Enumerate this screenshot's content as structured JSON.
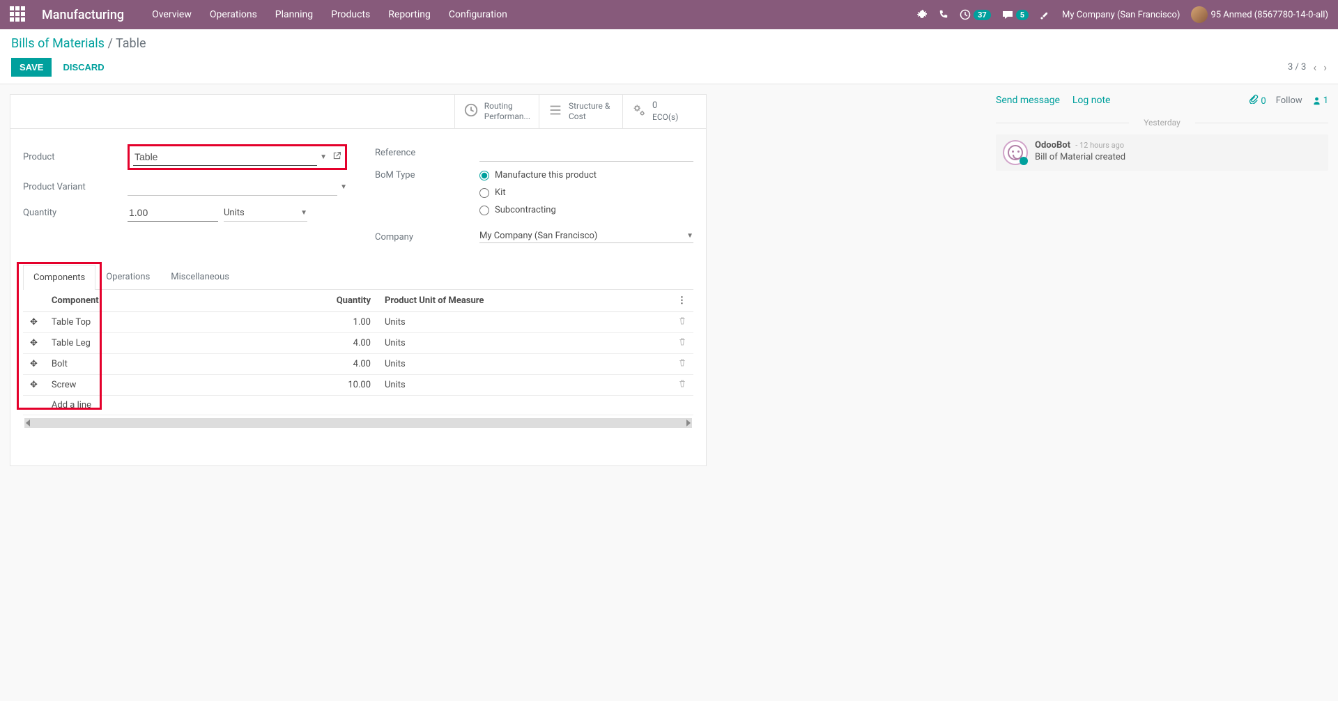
{
  "nav": {
    "brand": "Manufacturing",
    "menu": [
      "Overview",
      "Operations",
      "Planning",
      "Products",
      "Reporting",
      "Configuration"
    ],
    "clock_badge": "37",
    "chat_badge": "5",
    "company": "My Company (San Francisco)",
    "user": "95 Anmed (8567780-14-0-all)"
  },
  "breadcrumb": {
    "root": "Bills of Materials",
    "current": "Table"
  },
  "buttons": {
    "save": "SAVE",
    "discard": "DISCARD"
  },
  "pager": {
    "text": "3 / 3"
  },
  "statbox": {
    "routing": {
      "l1": "Routing",
      "l2": "Performan..."
    },
    "structure": {
      "l1": "Structure &",
      "l2": "Cost"
    },
    "eco": {
      "num": "0",
      "label": "ECO(s)"
    }
  },
  "fields": {
    "product_label": "Product",
    "product_value": "Table",
    "variant_label": "Product Variant",
    "qty_label": "Quantity",
    "qty_value": "1.00",
    "qty_uom": "Units",
    "reference_label": "Reference",
    "bom_type_label": "BoM Type",
    "bom_types": {
      "manufacture": "Manufacture this product",
      "kit": "Kit",
      "sub": "Subcontracting"
    },
    "company_label": "Company",
    "company_value": "My Company (San Francisco)"
  },
  "tabs": [
    "Components",
    "Operations",
    "Miscellaneous"
  ],
  "table": {
    "headers": {
      "component": "Component",
      "quantity": "Quantity",
      "uom": "Product Unit of Measure"
    },
    "rows": [
      {
        "name": "Table Top",
        "qty": "1.00",
        "uom": "Units"
      },
      {
        "name": "Table Leg",
        "qty": "4.00",
        "uom": "Units"
      },
      {
        "name": "Bolt",
        "qty": "4.00",
        "uom": "Units"
      },
      {
        "name": "Screw",
        "qty": "10.00",
        "uom": "Units"
      }
    ],
    "add_line": "Add a line"
  },
  "chatter": {
    "send": "Send message",
    "log": "Log note",
    "attach_count": "0",
    "follow": "Follow",
    "follower_count": "1",
    "day": "Yesterday",
    "msg_author": "OdooBot",
    "msg_time": "- 12 hours ago",
    "msg_body": "Bill of Material created"
  }
}
